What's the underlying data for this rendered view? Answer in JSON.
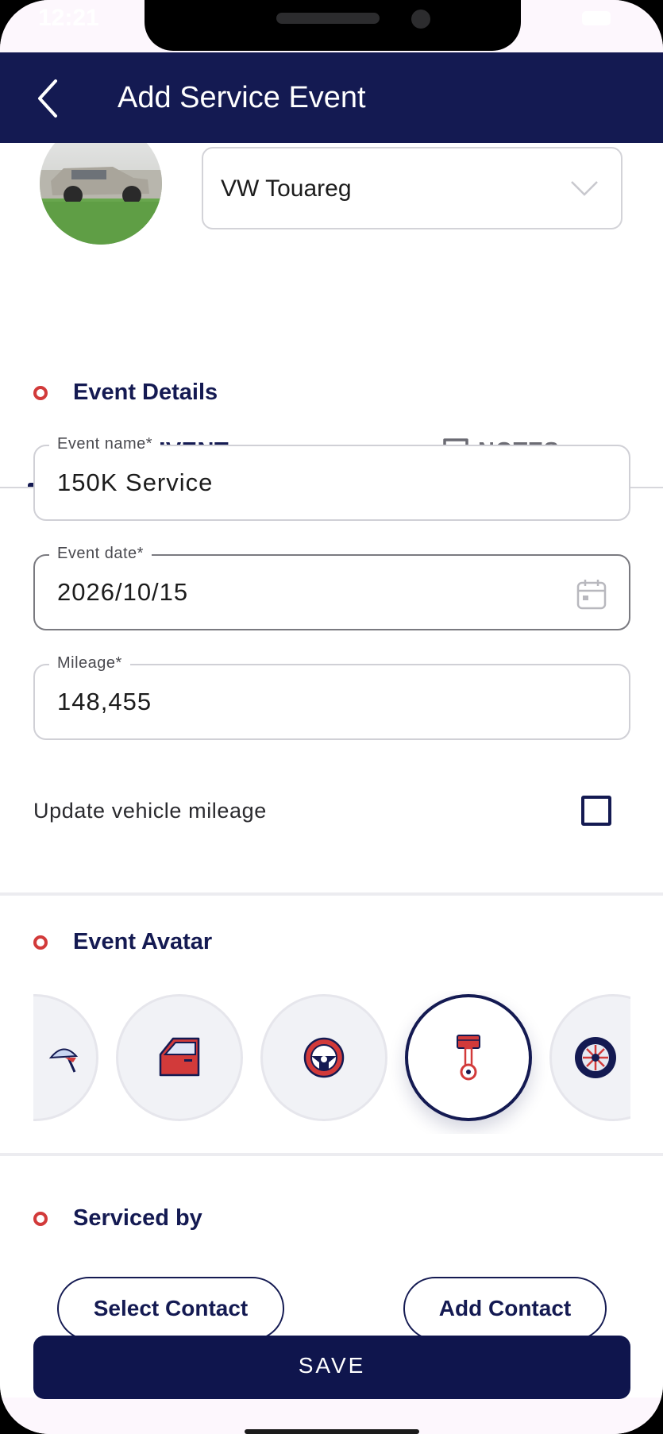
{
  "status": {
    "time": "12:21"
  },
  "header": {
    "title": "Add Service Event"
  },
  "vehicle": {
    "selected": "VW Touareg"
  },
  "tabs": [
    {
      "label": "EVENT",
      "icon": "wheel-wrench-icon",
      "active": true
    },
    {
      "label": "NOTES",
      "icon": "note-icon",
      "active": false
    }
  ],
  "event_details": {
    "section_title": "Event Details",
    "fields": {
      "name": {
        "label": "Event name*",
        "value": "150K Service"
      },
      "date": {
        "label": "Event date*",
        "value": "2026/10/15"
      },
      "mileage": {
        "label": "Mileage*",
        "value": "148,455"
      }
    },
    "update_mileage": {
      "label": "Update vehicle mileage",
      "checked": false
    }
  },
  "event_avatar": {
    "section_title": "Event Avatar",
    "items": [
      {
        "icon": "wiper-icon",
        "selected": false
      },
      {
        "icon": "car-door-icon",
        "selected": false
      },
      {
        "icon": "steering-wheel-icon",
        "selected": false
      },
      {
        "icon": "piston-icon",
        "selected": true
      },
      {
        "icon": "tire-icon",
        "selected": false
      }
    ]
  },
  "serviced_by": {
    "section_title": "Serviced by",
    "select_contact": "Select Contact",
    "add_contact": "Add Contact"
  },
  "save_label": "SAVE",
  "colors": {
    "primary": "#141a52",
    "accent": "#d23a3a",
    "background": "#ffffff"
  }
}
